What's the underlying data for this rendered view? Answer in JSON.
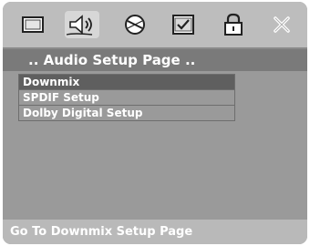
{
  "icon_bar": {
    "icons": [
      {
        "name": "general-setup-icon",
        "active": false
      },
      {
        "name": "audio-setup-icon",
        "active": true
      },
      {
        "name": "dolby-setup-icon",
        "active": false
      },
      {
        "name": "preference-icon",
        "active": false
      },
      {
        "name": "password-lock-icon",
        "active": false
      },
      {
        "name": "exit-icon",
        "active": false
      }
    ]
  },
  "page_title": ".. Audio Setup Page ..",
  "menu": {
    "items": [
      {
        "label": "Downmix",
        "selected": true
      },
      {
        "label": "SPDIF Setup",
        "selected": false
      },
      {
        "label": "Dolby Digital Setup",
        "selected": false
      }
    ]
  },
  "status_text": "Go To Downmix Setup Page",
  "colors": {
    "screen_bg": "#9a9a9a",
    "icon_bar_bg": "#bdbdbd",
    "title_bar_bg": "#7a7a7a",
    "selected_item_bg": "#5f5f5f",
    "status_bar_bg": "#b9b9b9",
    "text": "#ffffff"
  }
}
